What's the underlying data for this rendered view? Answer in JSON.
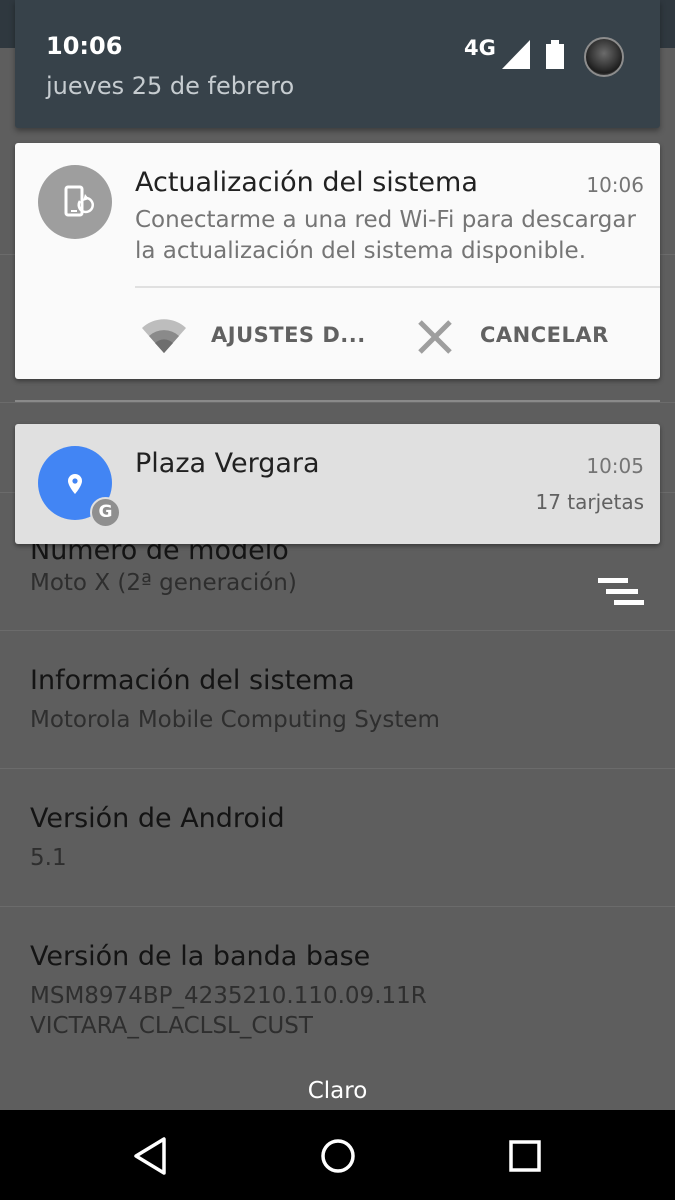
{
  "status_bar": {
    "time": "10:06",
    "date": "jueves 25 de febrero",
    "network": "4G",
    "icons": [
      "signal-icon",
      "battery-icon",
      "avatar"
    ]
  },
  "notifications": [
    {
      "app_icon": "phone-update-icon",
      "title": "Actualización del sistema",
      "time": "10:06",
      "body": "Conectarme a una red Wi-Fi para descargar la actualización del sistema disponible.",
      "actions": [
        {
          "icon": "wifi-icon",
          "label": "AJUSTES D..."
        },
        {
          "icon": "close-icon",
          "label": "CANCELAR"
        }
      ]
    },
    {
      "app_icon": "location-pin-icon",
      "badge": "G",
      "title": "Plaza Vergara",
      "time": "10:05",
      "detail": "17 tarjetas"
    }
  ],
  "settings_list": [
    {
      "title": "Número de modelo",
      "value": "Moto X (2ª generación)"
    },
    {
      "title": "Información del sistema",
      "value": "Motorola Mobile Computing System"
    },
    {
      "title": "Versión de Android",
      "value": "5.1"
    },
    {
      "title": "Versión de la banda base",
      "value_lines": [
        "MSM8974BP_4235210.110.09.11R",
        "VICTARA_CLACLSL_CUST"
      ]
    }
  ],
  "carrier": "Claro",
  "colors": {
    "header_bg": "#37424a",
    "maps_blue": "#4285f4",
    "update_icon_gray": "#9e9e9e"
  }
}
